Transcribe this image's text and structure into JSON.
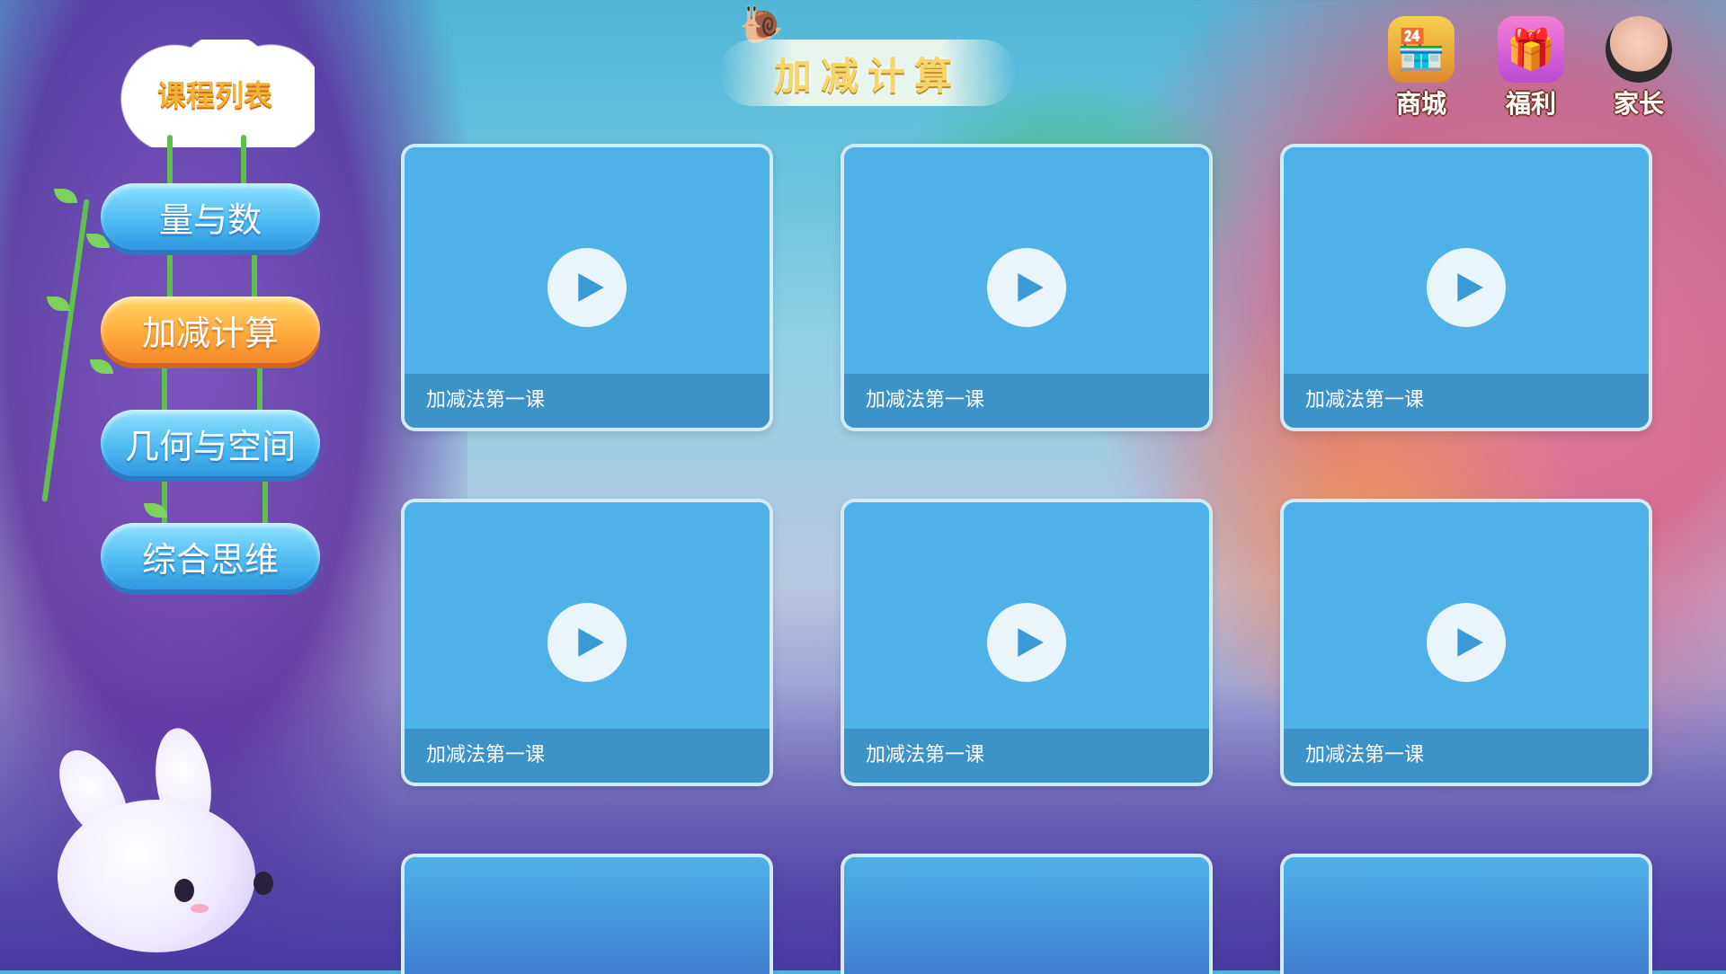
{
  "header": {
    "title": "加减计算"
  },
  "top_icons": [
    {
      "name": "shop",
      "label": "商城",
      "icon": "shop-icon"
    },
    {
      "name": "gift",
      "label": "福利",
      "icon": "gift-icon"
    },
    {
      "name": "parent",
      "label": "家长",
      "icon": "parent-avatar-icon"
    }
  ],
  "sidebar": {
    "heading": "课程列表",
    "items": [
      {
        "label": "量与数",
        "active": false
      },
      {
        "label": "加减计算",
        "active": true
      },
      {
        "label": "几何与空间",
        "active": false
      },
      {
        "label": "综合思维",
        "active": false
      }
    ]
  },
  "lessons": [
    {
      "title": "加减法第一课"
    },
    {
      "title": "加减法第一课"
    },
    {
      "title": "加减法第一课"
    },
    {
      "title": "加减法第一课"
    },
    {
      "title": "加减法第一课"
    },
    {
      "title": "加减法第一课"
    },
    {
      "title": ""
    },
    {
      "title": ""
    },
    {
      "title": ""
    }
  ],
  "colors": {
    "card_bg": "#4eb1e7",
    "caption_bg": "#3d93c8",
    "active_pill": "#ffab3d",
    "pill": "#4fbdf2"
  }
}
